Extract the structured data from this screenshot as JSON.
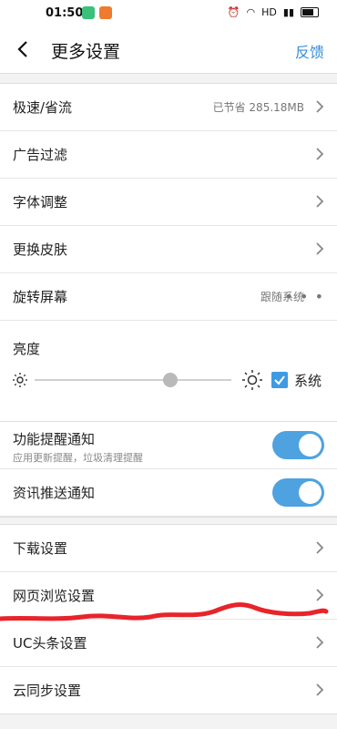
{
  "status_bar": {
    "time": "01:50",
    "network": "HD"
  },
  "header": {
    "title": "更多设置",
    "feedback": "反馈"
  },
  "section1": {
    "items": [
      {
        "label": "极速/省流",
        "value": "已节省 285.18MB",
        "type": "chevron"
      },
      {
        "label": "广告过滤",
        "value": "",
        "type": "chevron"
      },
      {
        "label": "字体调整",
        "value": "",
        "type": "chevron"
      },
      {
        "label": "更换皮肤",
        "value": "",
        "type": "chevron"
      },
      {
        "label": "旋转屏幕",
        "value": "跟随系统",
        "type": "more"
      }
    ],
    "brightness": {
      "label": "亮度",
      "system_label": "系统",
      "system_checked": true,
      "level": 0.69
    }
  },
  "section2": {
    "toggles": [
      {
        "label": "功能提醒通知",
        "subtitle": "应用更新提醒，垃圾清理提醒",
        "on": true
      },
      {
        "label": "资讯推送通知",
        "subtitle": "",
        "on": true
      }
    ]
  },
  "section3": {
    "items": [
      {
        "label": "下载设置"
      },
      {
        "label": "网页浏览设置"
      },
      {
        "label": "UC头条设置"
      },
      {
        "label": "云同步设置"
      }
    ]
  },
  "colors": {
    "accent": "#3a8fd8",
    "toggle_on": "#4ea2e0",
    "scribble": "#e8242a"
  }
}
